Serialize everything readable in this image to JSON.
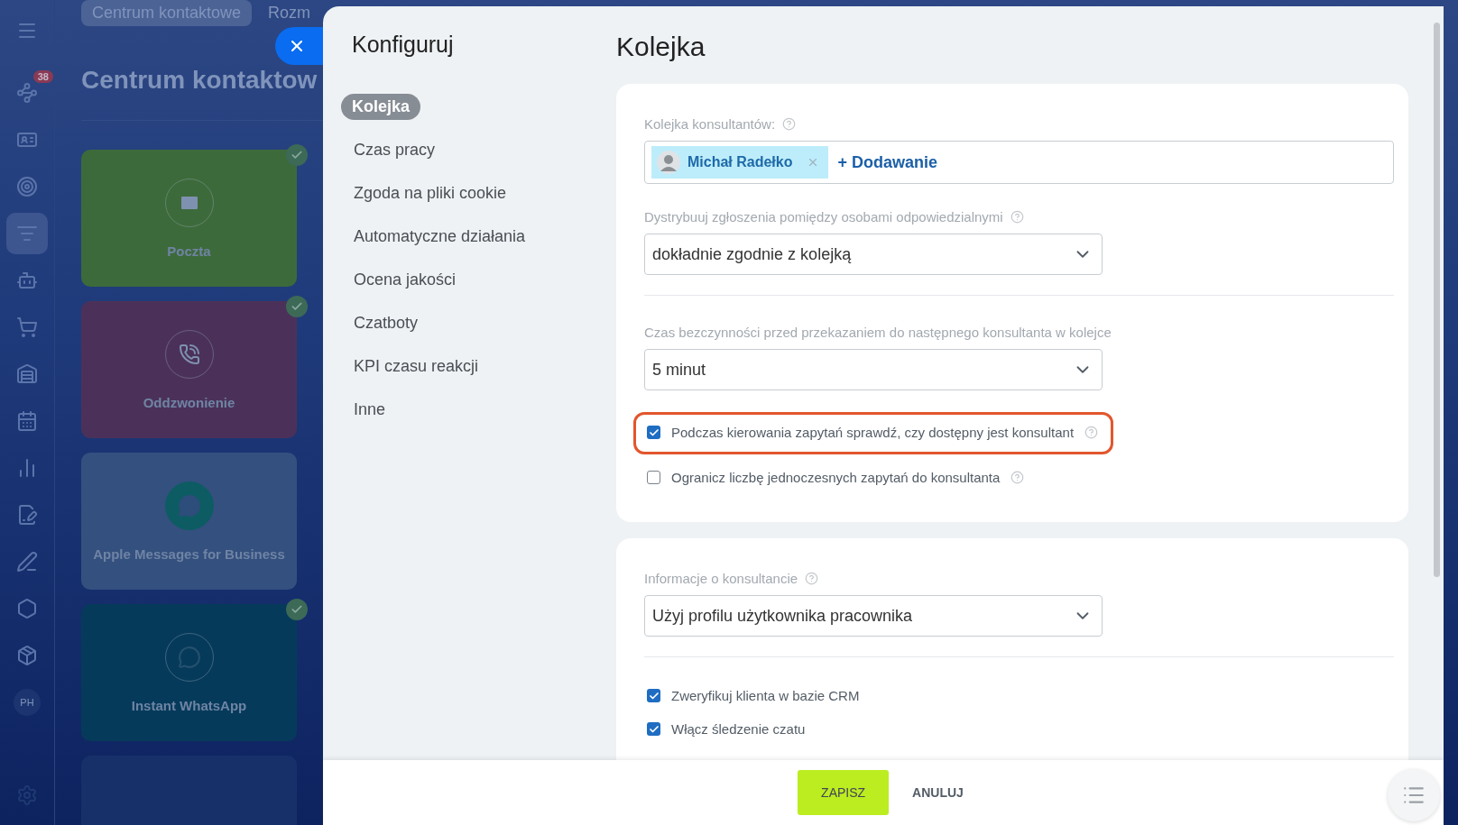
{
  "sidebar": {
    "badge": "38",
    "avatar": "PH"
  },
  "background": {
    "tabs": [
      {
        "label": "Centrum kontaktowe",
        "selected": true
      },
      {
        "label": "Rozm",
        "selected": false
      }
    ],
    "title": "Centrum kontaktow",
    "tiles": [
      {
        "kind": "mail",
        "label": "Poczta",
        "connected": true,
        "color": "#3d6a3a"
      },
      {
        "kind": "phone",
        "label": "Oddzwonienie",
        "connected": true,
        "color": "#4b3159"
      },
      {
        "kind": "chat",
        "label": "Apple Messages for Business",
        "connected": false,
        "color": "#34507f"
      },
      {
        "kind": "whatsapp",
        "label": "Instant WhatsApp",
        "connected": true,
        "color": "#063a5a"
      },
      {
        "kind": "empty",
        "connected": false,
        "color": "#17306a"
      }
    ]
  },
  "nav": {
    "title": "Konfiguruj",
    "items": [
      {
        "label": "Kolejka",
        "selected": true
      },
      {
        "label": "Czas pracy",
        "selected": false
      },
      {
        "label": "Zgoda na pliki cookie",
        "selected": false
      },
      {
        "label": "Automatyczne działania",
        "selected": false
      },
      {
        "label": "Ocena jakości",
        "selected": false
      },
      {
        "label": "Czatboty",
        "selected": false
      },
      {
        "label": "KPI czasu reakcji",
        "selected": false
      },
      {
        "label": "Inne",
        "selected": false
      }
    ]
  },
  "page_title": "Kolejka",
  "cards": [
    {
      "sections": [
        {
          "kind": "users",
          "label": "Kolejka konsultantów:",
          "help": true,
          "users": [
            "Michał Radełko"
          ],
          "add": "+ Dodawanie"
        },
        {
          "kind": "select",
          "label": "Dystrybuuj zgłoszenia pomiędzy osobami odpowiedzialnymi",
          "help": true,
          "value": "dokładnie zgodnie z kolejką",
          "divider": true
        },
        {
          "kind": "select",
          "label": "Czas bezczynności przed przekazaniem do następnego konsultanta w kolejce",
          "help": false,
          "value": "5 minut"
        },
        {
          "kind": "checkbox",
          "label": "Podczas kierowania zapytań sprawdź, czy dostępny jest konsultant",
          "checked": true,
          "help": true,
          "highlighted": true
        },
        {
          "kind": "checkbox",
          "label": "Ogranicz liczbę jednoczesnych zapytań do konsultanta",
          "checked": false,
          "help": true,
          "highlighted": false
        }
      ]
    },
    {
      "sections": [
        {
          "kind": "select",
          "label": "Informacje o konsultancie",
          "help": true,
          "value": "Użyj profilu użytkownika pracownika",
          "divider": true
        },
        {
          "kind": "checkbox",
          "label": "Zweryfikuj klienta w bazie CRM",
          "checked": true,
          "help": false,
          "highlighted": false
        },
        {
          "kind": "checkbox",
          "label": "Włącz śledzenie czatu",
          "checked": true,
          "help": false,
          "highlighted": false
        }
      ]
    }
  ],
  "footer": {
    "save": "ZAPISZ",
    "cancel": "ANULUJ"
  }
}
